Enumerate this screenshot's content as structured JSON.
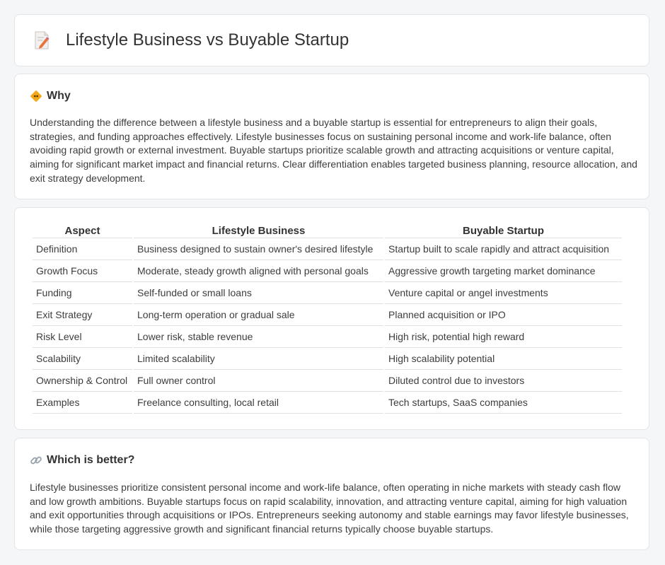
{
  "header": {
    "title": "Lifestyle Business vs Buyable Startup",
    "icon": "document-pencil-icon"
  },
  "why": {
    "heading": "Why",
    "icon": "diamond-sign-icon",
    "body": "Understanding the difference between a lifestyle business and a buyable startup is essential for entrepreneurs to align their goals, strategies, and funding approaches effectively. Lifestyle businesses focus on sustaining personal income and work-life balance, often avoiding rapid growth or external investment. Buyable startups prioritize scalable growth and attracting acquisitions or venture capital, aiming for significant market impact and financial returns. Clear differentiation enables targeted business planning, resource allocation, and exit strategy development."
  },
  "table": {
    "headers": [
      "Aspect",
      "Lifestyle Business",
      "Buyable Startup"
    ],
    "rows": [
      [
        "Definition",
        "Business designed to sustain owner's desired lifestyle",
        "Startup built to scale rapidly and attract acquisition"
      ],
      [
        "Growth Focus",
        "Moderate, steady growth aligned with personal goals",
        "Aggressive growth targeting market dominance"
      ],
      [
        "Funding",
        "Self-funded or small loans",
        "Venture capital or angel investments"
      ],
      [
        "Exit Strategy",
        "Long-term operation or gradual sale",
        "Planned acquisition or IPO"
      ],
      [
        "Risk Level",
        "Lower risk, stable revenue",
        "High risk, potential high reward"
      ],
      [
        "Scalability",
        "Limited scalability",
        "High scalability potential"
      ],
      [
        "Ownership & Control",
        "Full owner control",
        "Diluted control due to investors"
      ],
      [
        "Examples",
        "Freelance consulting, local retail",
        "Tech startups, SaaS companies"
      ]
    ]
  },
  "better": {
    "heading": "Which is better?",
    "icon": "link-icon",
    "body": "Lifestyle businesses prioritize consistent personal income and work-life balance, often operating in niche markets with steady cash flow and low growth ambitions. Buyable startups focus on rapid scalability, innovation, and attracting venture capital, aiming for high valuation and exit opportunities through acquisitions or IPOs. Entrepreneurs seeking autonomy and stable earnings may favor lifestyle businesses, while those targeting aggressive growth and significant financial returns typically choose buyable startups."
  }
}
